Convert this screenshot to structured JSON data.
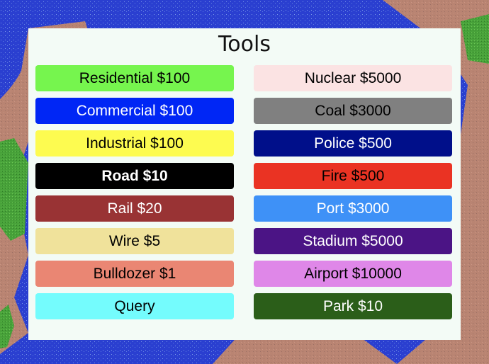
{
  "dialog": {
    "title": "Tools"
  },
  "tools_left": [
    {
      "label": "Residential $100",
      "bg": "#76f54e",
      "fg": "#000000"
    },
    {
      "label": "Commercial $100",
      "bg": "#0026f5",
      "fg": "#ffffff"
    },
    {
      "label": "Industrial $100",
      "bg": "#fdfb50",
      "fg": "#000000"
    },
    {
      "label": "Road $10",
      "bg": "#000000",
      "fg": "#ffffff",
      "bold": true
    },
    {
      "label": "Rail $20",
      "bg": "#993334",
      "fg": "#ffffff"
    },
    {
      "label": "Wire $5",
      "bg": "#f0e29b",
      "fg": "#000000"
    },
    {
      "label": "Bulldozer $1",
      "bg": "#ea8673",
      "fg": "#000000"
    },
    {
      "label": "Query",
      "bg": "#74fcfd",
      "fg": "#000000"
    }
  ],
  "tools_right": [
    {
      "label": "Nuclear $5000",
      "bg": "#fbe3e3",
      "fg": "#000000"
    },
    {
      "label": "Coal $3000",
      "bg": "#808080",
      "fg": "#000000"
    },
    {
      "label": "Police $500",
      "bg": "#000f8a",
      "fg": "#ffffff"
    },
    {
      "label": "Fire $500",
      "bg": "#ea3323",
      "fg": "#000000"
    },
    {
      "label": "Port $3000",
      "bg": "#3e91f7",
      "fg": "#ffffff"
    },
    {
      "label": "Stadium $5000",
      "bg": "#4b1485",
      "fg": "#ffffff"
    },
    {
      "label": "Airport $10000",
      "bg": "#df87e8",
      "fg": "#000000"
    },
    {
      "label": "Park $10",
      "bg": "#2b5e19",
      "fg": "#ffffff"
    }
  ],
  "map_colors": {
    "water": "#2a3fd0",
    "water_speckle": "#7a98e8",
    "land": "#b98472",
    "land_speckle": "#8f6a60",
    "forest": "#4aa83a"
  }
}
